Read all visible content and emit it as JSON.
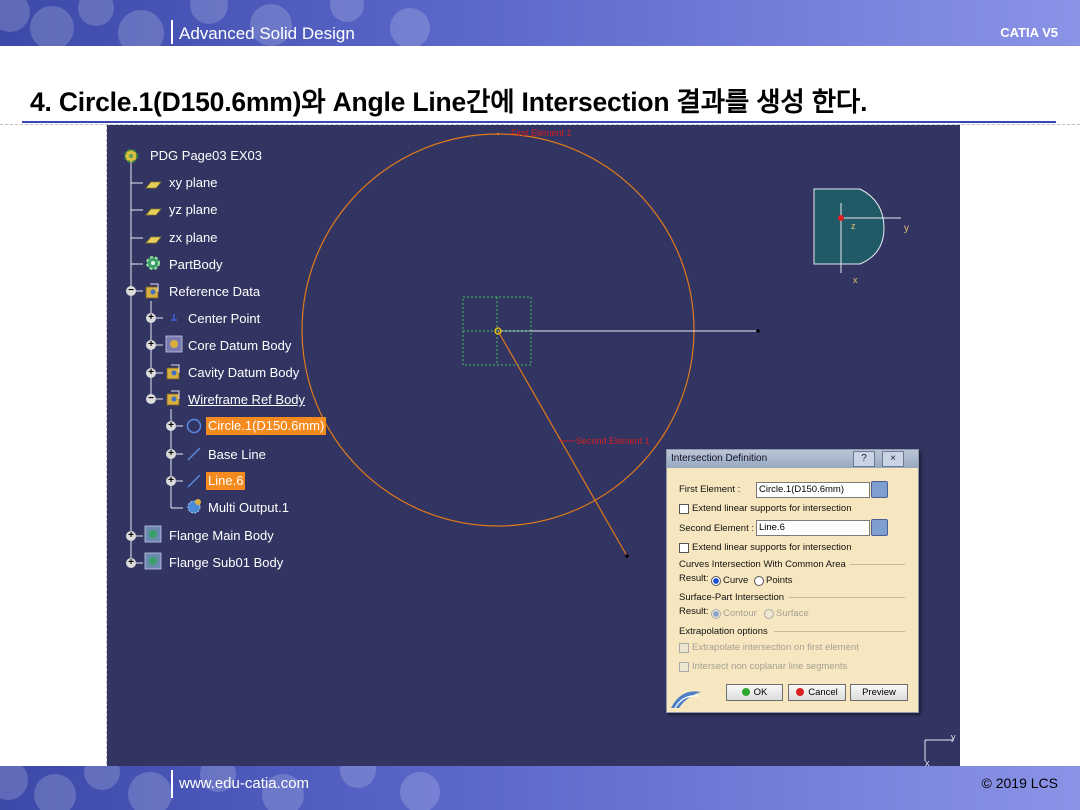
{
  "header": {
    "title": "Advanced Solid Design",
    "right": "CATIA V5"
  },
  "page_title": "4. Circle.1(D150.6mm)와 Angle Line간에 Intersection 결과를 생성 한다.",
  "footer": {
    "url": "www.edu-catia.com",
    "copyright": "© 2019 LCS"
  },
  "tree": {
    "root": "PDG Page03 EX03",
    "nodes": [
      {
        "label": "xy plane",
        "icon": "plane-icon"
      },
      {
        "label": "yz plane",
        "icon": "plane-icon"
      },
      {
        "label": "zx plane",
        "icon": "plane-icon"
      },
      {
        "label": "PartBody",
        "icon": "partbody-gear-icon"
      },
      {
        "label": "Reference Data",
        "icon": "geometrical-set-icon"
      },
      {
        "label": "Center Point",
        "icon": "point-icon"
      },
      {
        "label": "Core Datum Body",
        "icon": "geometrical-set-icon"
      },
      {
        "label": "Cavity Datum Body",
        "icon": "geometrical-set-icon"
      },
      {
        "label": "Wireframe Ref Body",
        "icon": "geometrical-set-icon"
      },
      {
        "label": "Circle.1(D150.6mm)",
        "icon": "circle-icon"
      },
      {
        "label": "Base Line",
        "icon": "line-icon"
      },
      {
        "label": "Line.6",
        "icon": "line-icon"
      },
      {
        "label": "Multi Output.1",
        "icon": "multi-output-icon"
      },
      {
        "label": "Flange Main Body",
        "icon": "geometrical-set-icon"
      },
      {
        "label": "Flange Sub01 Body",
        "icon": "geometrical-set-icon"
      }
    ]
  },
  "viewport": {
    "first_element_tag": "First Element 1",
    "second_element_tag": "Second Element 1",
    "compass_labels": {
      "z": "z",
      "y": "y",
      "x": "x"
    },
    "axis_labels": {
      "y": "y",
      "x": "x"
    }
  },
  "dialog": {
    "title": "Intersection Definition",
    "help_button": "?",
    "close_button": "×",
    "first_element_label": "First Element :",
    "first_element_value": "Circle.1(D150.6mm)",
    "extend1": "Extend linear supports for intersection",
    "second_element_label": "Second Element :",
    "second_element_value": "Line.6",
    "extend2": "Extend linear supports for intersection",
    "curves_section": "Curves Intersection With Common Area",
    "result_label": "Result:",
    "curve": "Curve",
    "points": "Points",
    "surface_section": "Surface-Part Intersection",
    "result_label2": "Result:",
    "contour": "Contour",
    "surface": "Surface",
    "extrapolation_section": "Extrapolation options",
    "extrapolate": "Extrapolate intersection on first element",
    "intersect_non_coplanar": "Intersect non coplanar line segments",
    "ok": "OK",
    "cancel": "Cancel",
    "preview": "Preview"
  },
  "colors": {
    "viewport_bg": "#323462",
    "highlight": "#f58a1f",
    "circle": "#e07a1a",
    "banner": "#3c49a8"
  }
}
